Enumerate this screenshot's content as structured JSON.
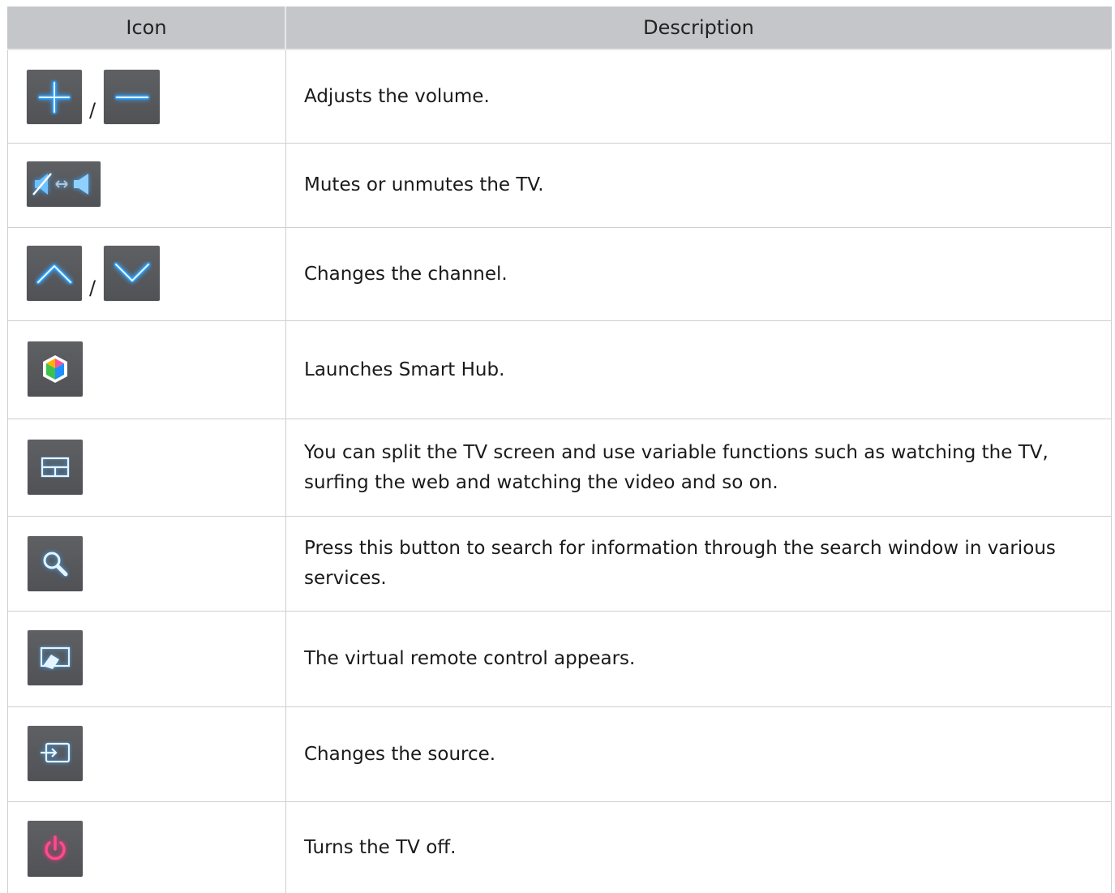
{
  "table": {
    "headers": {
      "icon": "Icon",
      "description": "Description"
    },
    "rows": [
      {
        "icon": "volume-up-down-icons",
        "separator": "/",
        "description": "Adjusts the volume."
      },
      {
        "icon": "mute-toggle-icon",
        "description": "Mutes or unmutes the TV."
      },
      {
        "icon": "channel-up-down-icons",
        "separator": "/",
        "description": "Changes the channel."
      },
      {
        "icon": "smart-hub-icon",
        "description": "Launches Smart Hub."
      },
      {
        "icon": "multi-screen-icon",
        "description": "You can split the TV screen and use variable functions such as watching the TV, surfing the web and watching the video and so on."
      },
      {
        "icon": "search-icon",
        "description": "Press this button to search for information through the search window in various services."
      },
      {
        "icon": "virtual-remote-icon",
        "description": "The virtual remote control appears."
      },
      {
        "icon": "source-icon",
        "description": "Changes the source."
      },
      {
        "icon": "power-icon",
        "description": "Turns the TV off."
      }
    ]
  },
  "colors": {
    "header_bg": "#c4c6c9",
    "button_bg": "#55575b",
    "icon_blue": "#2aa0ff",
    "power_pink": "#ff2e7e"
  }
}
